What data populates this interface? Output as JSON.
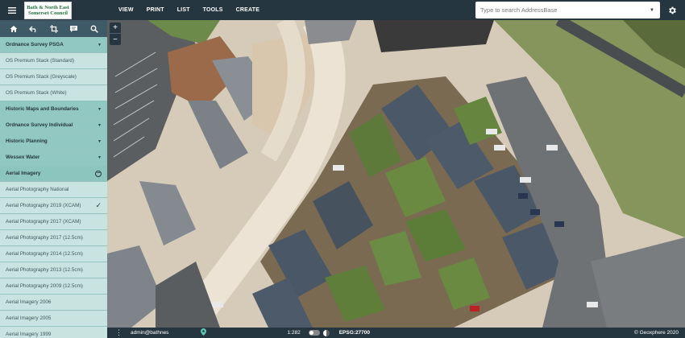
{
  "header": {
    "logo_line1": "Bath & North East",
    "logo_line2": "Somerset Council",
    "menu": [
      "VIEW",
      "PRINT",
      "LIST",
      "TOOLS",
      "CREATE"
    ],
    "search_placeholder": "Type to search AddressBase"
  },
  "sidebar": {
    "toolbar_icons": [
      "home-icon",
      "back-icon",
      "crop-icon",
      "comment-icon",
      "search-icon"
    ],
    "rows": [
      {
        "label": "Ordnance Survey PSGA",
        "type": "header",
        "state": "expanded-up"
      },
      {
        "label": "OS Premium Stack (Standard)",
        "type": "sub"
      },
      {
        "label": "OS Premium Stack (Greyscale)",
        "type": "sub"
      },
      {
        "label": "OS Premium Stack (White)",
        "type": "sub"
      },
      {
        "label": "Historic Maps and Boundaries",
        "type": "header",
        "state": "collapsed"
      },
      {
        "label": "Ordnance Survey Individual",
        "type": "header",
        "state": "collapsed"
      },
      {
        "label": "Historic Planning",
        "type": "header",
        "state": "collapsed"
      },
      {
        "label": "Wessex Water",
        "type": "header",
        "state": "collapsed"
      },
      {
        "label": "Aerial Imagery",
        "type": "header",
        "state": "open"
      },
      {
        "label": "Aerial Photography National",
        "type": "sub"
      },
      {
        "label": "Aerial Photography 2019 (XCAM)",
        "type": "sub",
        "selected": true
      },
      {
        "label": "Aerial Photography 2017 (XCAM)",
        "type": "sub"
      },
      {
        "label": "Aerial Photography 2017 (12.5cm)",
        "type": "sub"
      },
      {
        "label": "Aerial Photography 2014 (12.5cm)",
        "type": "sub"
      },
      {
        "label": "Aerial Photography 2013 (12.5cm)",
        "type": "sub"
      },
      {
        "label": "Aerial Photography 2009 (12.5cm)",
        "type": "sub"
      },
      {
        "label": "Aerial Imagery 2006",
        "type": "sub"
      },
      {
        "label": "Aerial Imagery 2005",
        "type": "sub"
      },
      {
        "label": "Aerial Imagery 1999",
        "type": "sub"
      }
    ]
  },
  "map": {
    "zoom_in": "+",
    "zoom_out": "−"
  },
  "statusbar": {
    "user": "admin@bathnes",
    "scale": "1:282",
    "epsg": "EPSG:27700",
    "copyright": "© Geoxphere 2020"
  },
  "colors": {
    "topbar": "#263640",
    "sidebar_header": "#92c8c2",
    "sidebar_sub": "#c7e4e0",
    "accent": "#5fcab5"
  }
}
